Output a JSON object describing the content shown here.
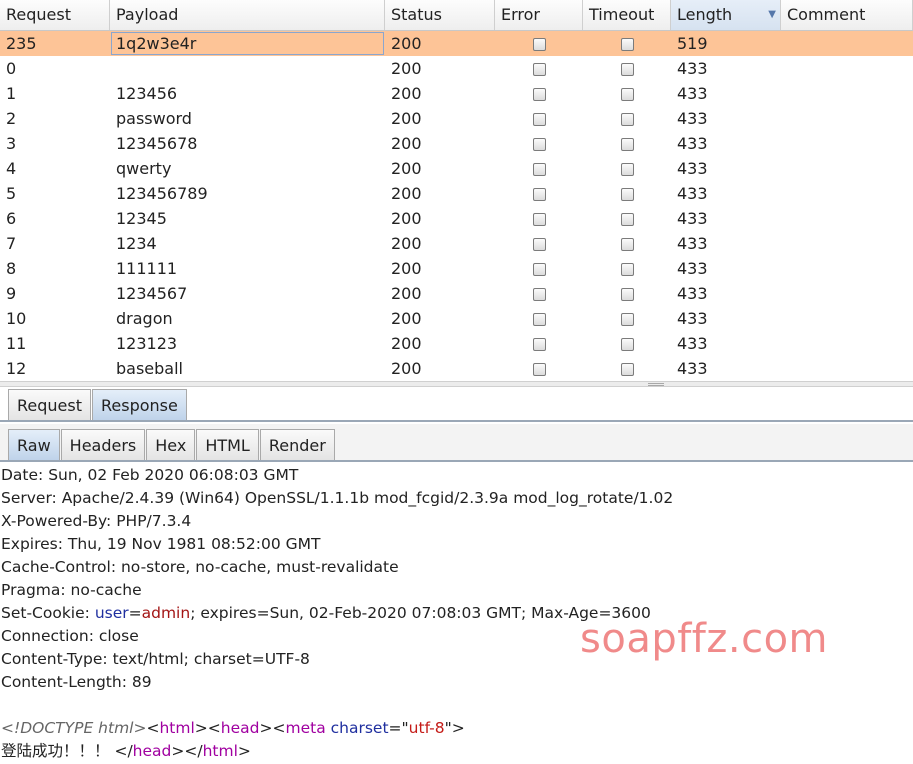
{
  "table": {
    "columns": [
      "Request",
      "Payload",
      "Status",
      "Error",
      "Timeout",
      "Length",
      "Comment"
    ],
    "sorted_column": "Length",
    "selected_color": "#fdc497",
    "rows": [
      {
        "request": "235",
        "payload": "1q2w3e4r",
        "status": "200",
        "length": "519",
        "selected": true
      },
      {
        "request": "0",
        "payload": "",
        "status": "200",
        "length": "433"
      },
      {
        "request": "1",
        "payload": "123456",
        "status": "200",
        "length": "433"
      },
      {
        "request": "2",
        "payload": "password",
        "status": "200",
        "length": "433"
      },
      {
        "request": "3",
        "payload": "12345678",
        "status": "200",
        "length": "433"
      },
      {
        "request": "4",
        "payload": "qwerty",
        "status": "200",
        "length": "433"
      },
      {
        "request": "5",
        "payload": "123456789",
        "status": "200",
        "length": "433"
      },
      {
        "request": "6",
        "payload": "12345",
        "status": "200",
        "length": "433"
      },
      {
        "request": "7",
        "payload": "1234",
        "status": "200",
        "length": "433"
      },
      {
        "request": "8",
        "payload": "111111",
        "status": "200",
        "length": "433"
      },
      {
        "request": "9",
        "payload": "1234567",
        "status": "200",
        "length": "433"
      },
      {
        "request": "10",
        "payload": "dragon",
        "status": "200",
        "length": "433"
      },
      {
        "request": "11",
        "payload": "123123",
        "status": "200",
        "length": "433"
      },
      {
        "request": "12",
        "payload": "baseball",
        "status": "200",
        "length": "433"
      }
    ]
  },
  "outer_tabs": {
    "request": "Request",
    "response": "Response",
    "active": "response"
  },
  "inner_tabs": {
    "raw": "Raw",
    "headers": "Headers",
    "hex": "Hex",
    "html": "HTML",
    "render": "Render",
    "active": "raw"
  },
  "response": {
    "headers": [
      "Date: Sun, 02 Feb 2020 06:08:03 GMT",
      "Server: Apache/2.4.39 (Win64) OpenSSL/1.1.1b mod_fcgid/2.3.9a mod_log_rotate/1.02",
      "X-Powered-By: PHP/7.3.4",
      "Expires: Thu, 19 Nov 1981 08:52:00 GMT",
      "Cache-Control: no-store, no-cache, must-revalidate",
      "Pragma: no-cache"
    ],
    "set_cookie": {
      "prefix": "Set-Cookie: ",
      "name": "user",
      "eq": "=",
      "value": "admin",
      "rest": "; expires=Sun, 02-Feb-2020 07:08:03 GMT; Max-Age=3600"
    },
    "headers_after": [
      "Connection: close",
      "Content-Type: text/html; charset=UTF-8",
      "Content-Length: 89"
    ],
    "body": {
      "doctype": "<!DOCTYPE html>",
      "lt": "<",
      "gt": ">",
      "lt_slash": "</",
      "tag_html": "html",
      "tag_head": "head",
      "tag_meta": "meta",
      "attr_charset": "charset",
      "attr_eq": "=\"",
      "attr_val": "utf-8",
      "attr_close": "\">",
      "text": "登陆成功！！！"
    }
  },
  "watermark": "soapffz.com"
}
